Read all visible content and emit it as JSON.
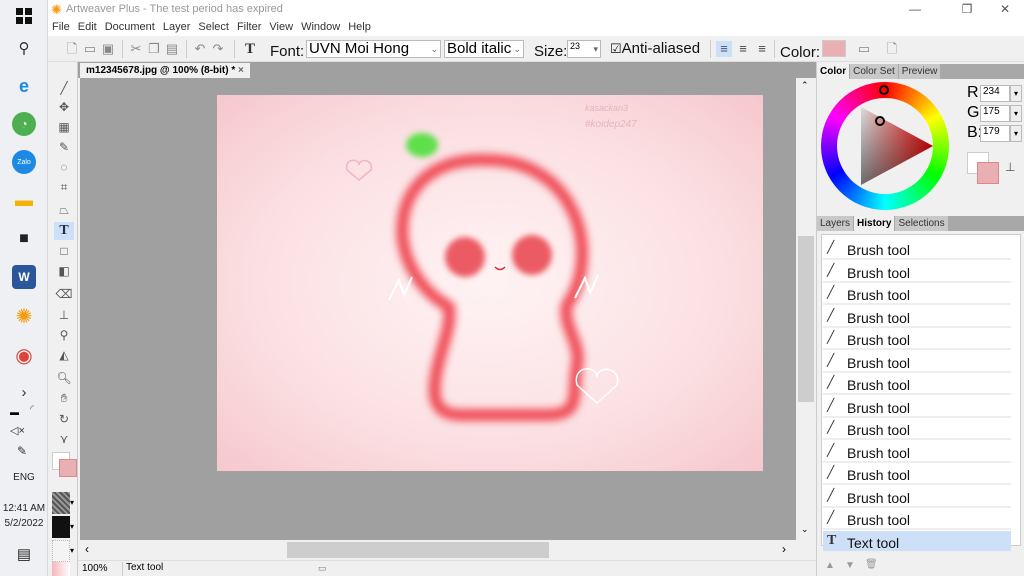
{
  "taskbar": {
    "language": "ENG",
    "time": "12:41 AM",
    "date": "5/2/2022"
  },
  "window": {
    "title": "Artweaver Plus - The test period has expired"
  },
  "menu": [
    "File",
    "Edit",
    "Document",
    "Layer",
    "Select",
    "Filter",
    "View",
    "Window",
    "Help"
  ],
  "toolbar": {
    "font_label": "Font:",
    "font_value": "UVN Moi Hong",
    "style_value": "Bold italic",
    "size_label": "Size:",
    "size_value": "23",
    "antialias_label": "Anti-aliased",
    "antialias_checked": true,
    "color_label": "Color:",
    "color_value": "#eaafb3"
  },
  "document": {
    "tab_title": "m12345678.jpg @ 100% (8-bit) *",
    "close": "×",
    "artwork_text": [
      "kasackan3",
      "#koidep247"
    ]
  },
  "status": {
    "zoom": "100%",
    "tool": "Text tool"
  },
  "color_panel": {
    "tabs": [
      "Color",
      "Color Set",
      "Preview"
    ],
    "r_label": "R:",
    "r": "234",
    "g_label": "G:",
    "g": "175",
    "b_label": "B:",
    "b": "179",
    "foreground": "#ffffff",
    "background": "#eaafb3"
  },
  "history_panel": {
    "tabs": [
      "Layers",
      "History",
      "Selections"
    ],
    "items": [
      {
        "label": "Brush tool"
      },
      {
        "label": "Brush tool"
      },
      {
        "label": "Brush tool"
      },
      {
        "label": "Brush tool"
      },
      {
        "label": "Brush tool"
      },
      {
        "label": "Brush tool"
      },
      {
        "label": "Brush tool"
      },
      {
        "label": "Brush tool"
      },
      {
        "label": "Brush tool"
      },
      {
        "label": "Brush tool"
      },
      {
        "label": "Brush tool"
      },
      {
        "label": "Brush tool"
      },
      {
        "label": "Brush tool"
      },
      {
        "label": "Text tool"
      }
    ]
  }
}
